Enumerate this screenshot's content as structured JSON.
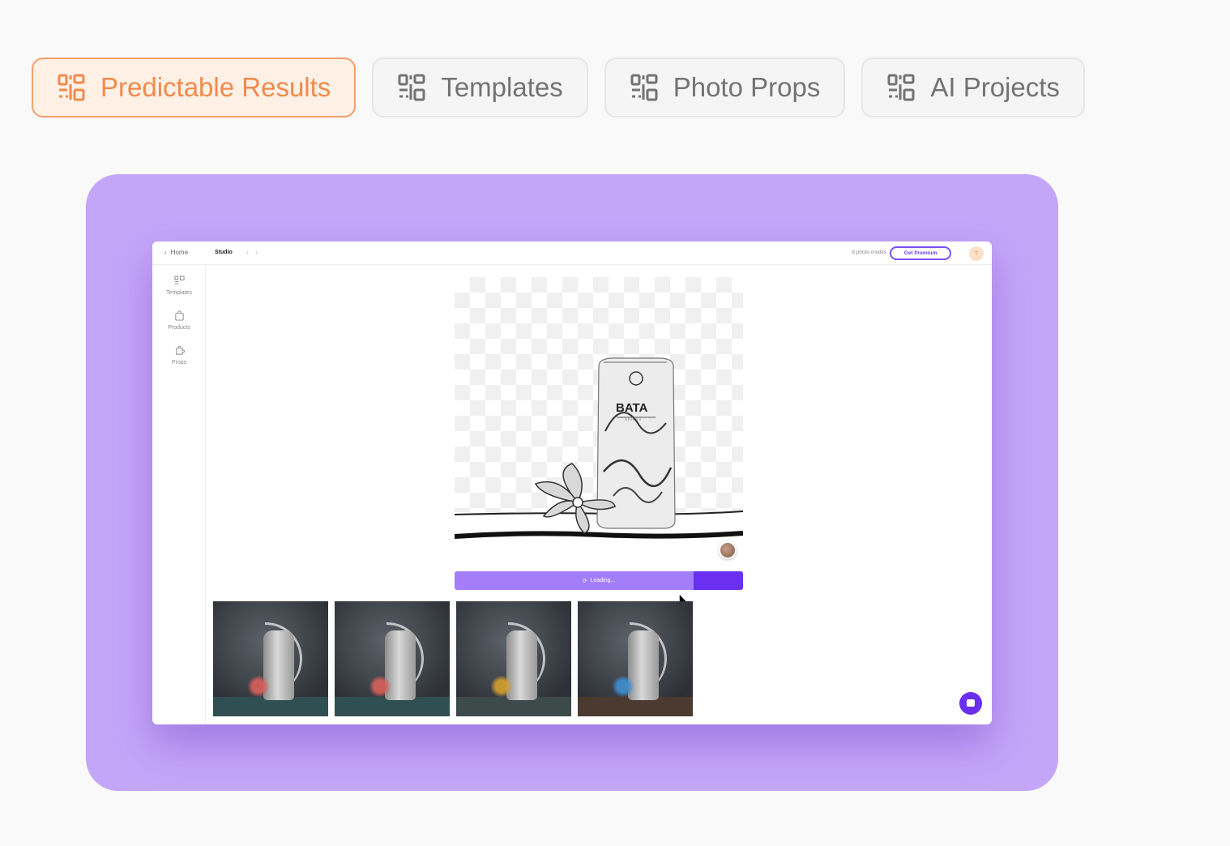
{
  "tabs": [
    {
      "label": "Predictable Results",
      "active": true
    },
    {
      "label": "Templates",
      "active": false
    },
    {
      "label": "Photo Props",
      "active": false
    },
    {
      "label": "AI Projects",
      "active": false
    }
  ],
  "tab_icon": "qr-code-icon",
  "colors": {
    "accent_orange": "#f08a4b",
    "stage_purple": "#c3a6f8",
    "brand_purple": "#6b2ff0",
    "loading_purple": "#a47dfa"
  },
  "app": {
    "breadcrumb_home": "Home",
    "section": "Studio",
    "credits": "8 photo credits",
    "premium_button": "Get Premium",
    "avatar_initial": "T",
    "sidebar": [
      {
        "label": "Templates",
        "icon": "templates-icon"
      },
      {
        "label": "Products",
        "icon": "bag-icon"
      },
      {
        "label": "Props",
        "icon": "puzzle-icon"
      }
    ],
    "canvas": {
      "product_brand": "BATA",
      "product_sub": "DRINKS"
    },
    "loading_label": "Loading...",
    "loading_progress": 0.17,
    "thumbnails": [
      {
        "flower_color": "#d9605a"
      },
      {
        "flower_color": "#d9605a"
      },
      {
        "flower_color": "#d4a030"
      },
      {
        "flower_color": "#3e8fd0"
      }
    ]
  }
}
